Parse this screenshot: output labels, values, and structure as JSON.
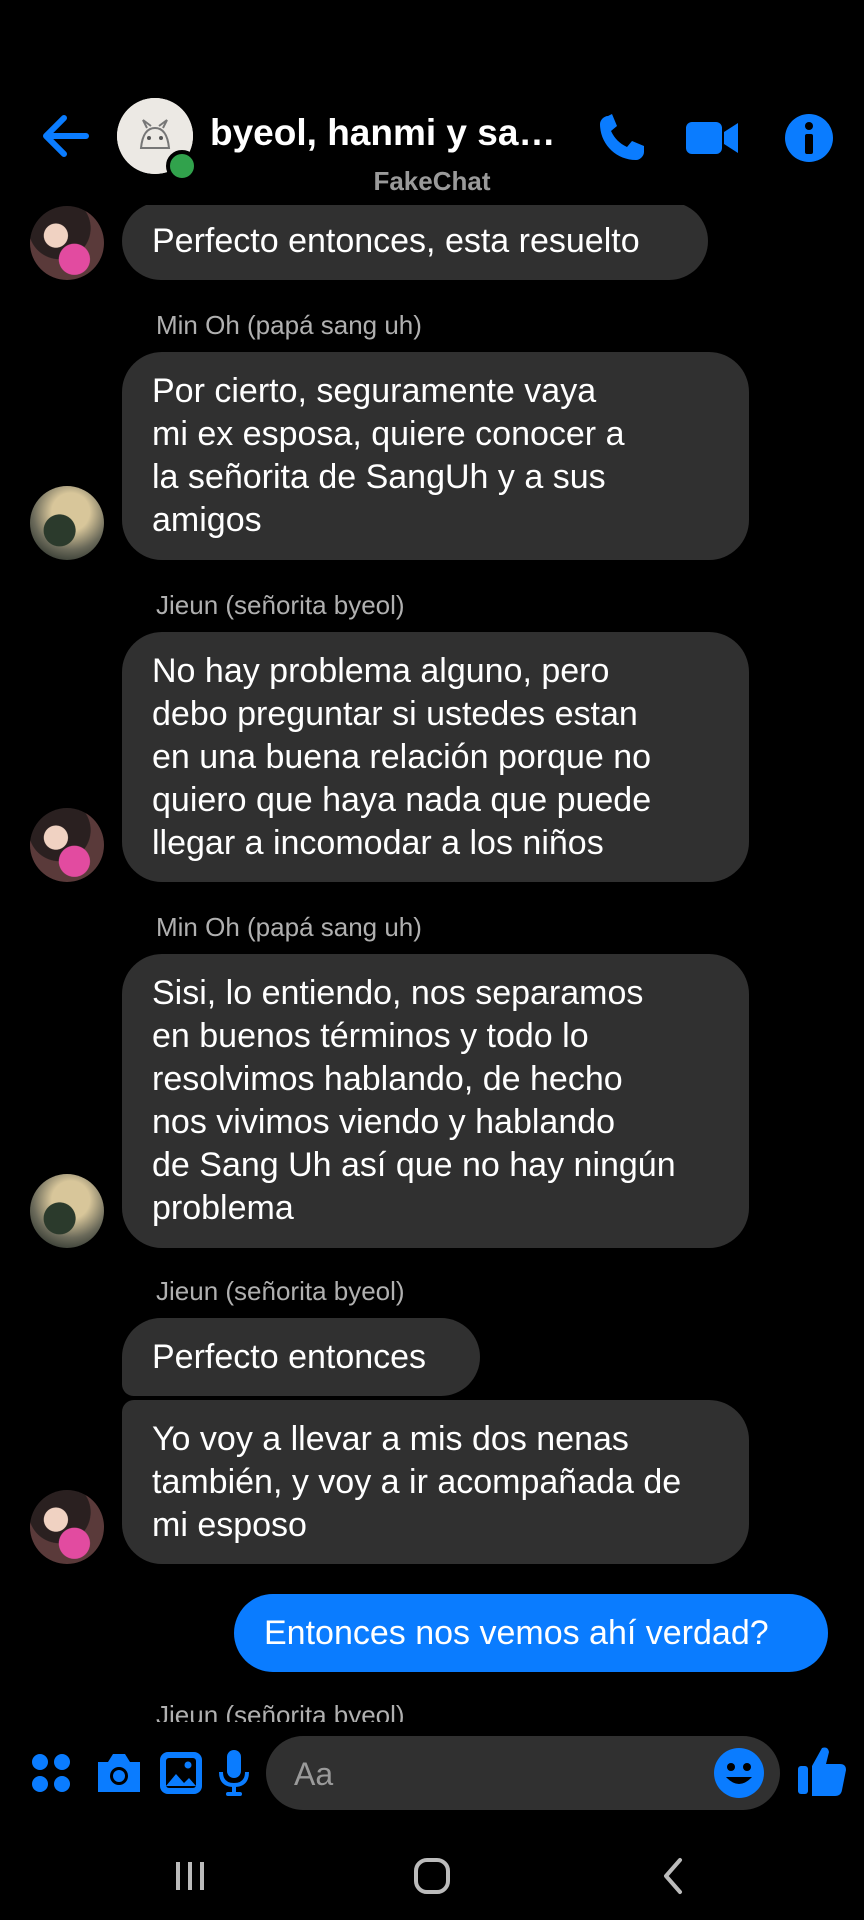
{
  "header": {
    "title": "byeol, hanmi y san...",
    "watermark": "FakeChat",
    "colors": {
      "accent": "#0a7cff",
      "online": "#31a24c"
    },
    "icons": [
      "back-arrow-icon",
      "phone-icon",
      "video-icon",
      "info-icon"
    ]
  },
  "messages": [
    {
      "id": "m1",
      "text": "Perfecto entonces, esta resuelto"
    },
    {
      "id": "s1",
      "sender": "Min Oh (papá sang uh)"
    },
    {
      "id": "m2",
      "text": "Por cierto, seguramente vaya\nmi ex esposa, quiere conocer a\nla señorita de SangUh y a sus\namigos"
    },
    {
      "id": "s2",
      "sender": "Jieun (señorita byeol)"
    },
    {
      "id": "m3",
      "text": "No hay problema alguno, pero\ndebo preguntar si ustedes estan\nen una buena relación porque no\nquiero que haya nada que puede\nllegar a incomodar a los niños"
    },
    {
      "id": "s3",
      "sender": "Min Oh (papá sang uh)"
    },
    {
      "id": "m4",
      "text": "Sisi, lo entiendo, nos separamos\nen buenos términos y todo lo\nresolvimos hablando, de hecho\nnos vivimos viendo y hablando\nde Sang Uh así que no hay ningún\nproblema"
    },
    {
      "id": "s4",
      "sender": "Jieun (señorita byeol)"
    },
    {
      "id": "m5",
      "text": "Perfecto entonces"
    },
    {
      "id": "m6",
      "text": "Yo voy a llevar a mis dos nenas\ntambién, y voy a ir acompañada de\nmi esposo"
    },
    {
      "id": "m7",
      "text": "Entonces nos vemos ahí verdad?",
      "mine": true
    },
    {
      "id": "s5",
      "sender": "Jieun (señorita byeol)"
    }
  ],
  "composer": {
    "placeholder": "Aa",
    "icons": [
      "apps-icon",
      "camera-icon",
      "gallery-icon",
      "microphone-icon",
      "emoji-icon",
      "like-icon"
    ]
  },
  "navbar": {
    "icons": [
      "recent-apps-icon",
      "home-icon",
      "back-icon"
    ]
  }
}
